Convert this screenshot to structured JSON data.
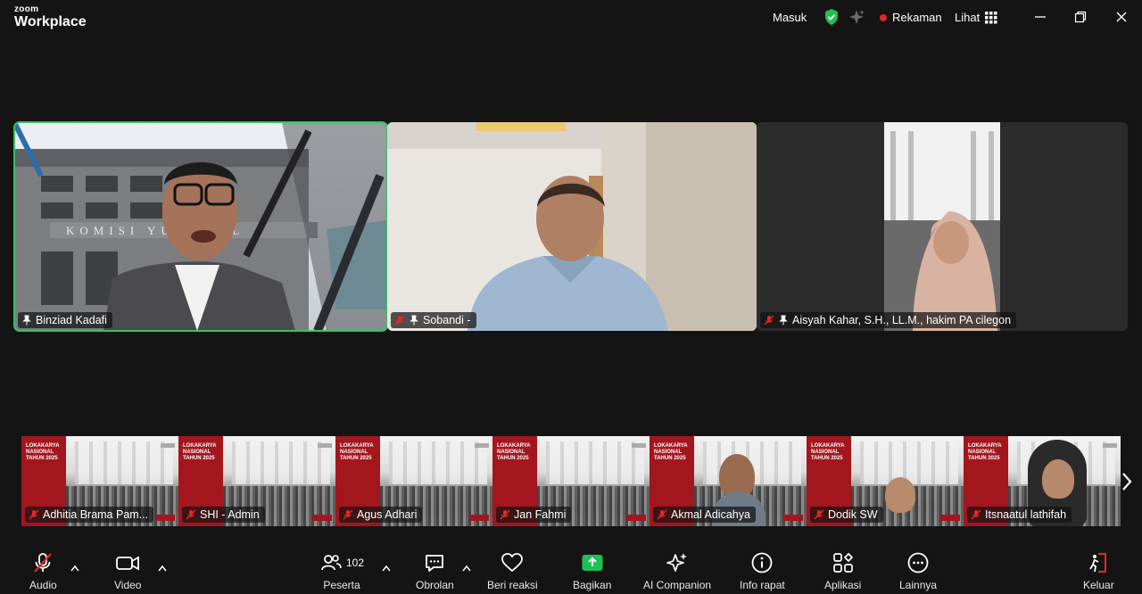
{
  "app": {
    "brand_small": "zoom",
    "brand_big": "Workplace"
  },
  "titlebar": {
    "masuk": "Masuk",
    "recording": "Rekaman",
    "view": "Lihat"
  },
  "main_tiles": [
    {
      "name": "Binziad Kadafi"
    },
    {
      "name": "Sobandi -"
    },
    {
      "name": "Aisyah Kahar, S.H., LL.M., hakim PA cilegon"
    }
  ],
  "strip": {
    "slide_title": "LOKAKARYA NASIONAL TAHUN 2025",
    "tiles": [
      {
        "name": "Adhitia Brama Pam..."
      },
      {
        "name": "SHI - Admin"
      },
      {
        "name": "Agus Adhari"
      },
      {
        "name": "Jan Fahmi"
      },
      {
        "name": "Akmal Adicahya"
      },
      {
        "name": "Dodik SW"
      },
      {
        "name": "Itsnaatul lathifah"
      }
    ]
  },
  "toolbar": {
    "audio": "Audio",
    "video": "Video",
    "participants": "Peserta",
    "participants_count": "102",
    "chat": "Obrolan",
    "react": "Beri reaksi",
    "share": "Bagikan",
    "ai": "AI Companion",
    "info": "Info rapat",
    "apps": "Aplikasi",
    "more": "Lainnya",
    "leave": "Keluar"
  },
  "colors": {
    "active_speaker": "#33c26a",
    "share": "#1fbf55",
    "recording": "#e02828",
    "slide_red": "#a3161e"
  }
}
